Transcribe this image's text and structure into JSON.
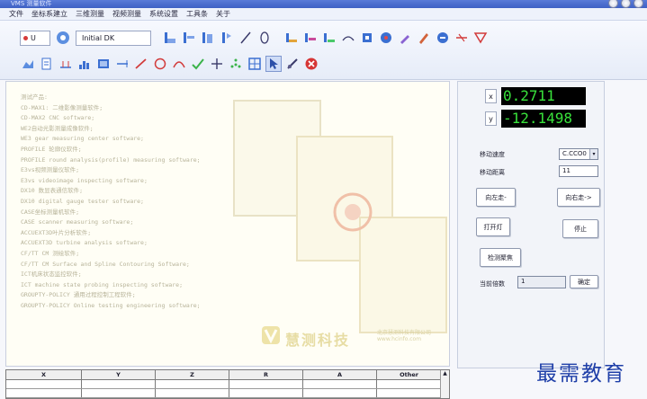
{
  "window": {
    "title": "VMS 测量软件"
  },
  "menu": [
    "文件",
    "坐标系建立",
    "三维测量",
    "视频测量",
    "系统设置",
    "工具条",
    "关于"
  ],
  "toolbar": {
    "unit_value": "U",
    "combo_value": "Initial DK",
    "row1_tools": [
      "point-tool-icon",
      "line-tool-icon",
      "circle-tool-icon",
      "arc-tool-icon",
      "line-draw-icon",
      "ellipse-tool-icon",
      "distance-tool-icon",
      "angle-tool-icon",
      "width-tool-icon",
      "arc-measure-icon",
      "rect-tool-icon",
      "probe-tool-icon",
      "pen-tool-icon",
      "edit-tool-icon",
      "erase-tool-icon",
      "cross-tool-icon",
      "filter-tool-icon"
    ],
    "row2_tools": [
      "area-tool-icon",
      "profile-tool-icon",
      "grid-tool-icon",
      "chart-tool-icon",
      "picture-tool-icon",
      "dimension-tool-icon",
      "red-line-icon",
      "circle-red-icon",
      "arc-red-icon",
      "check-tool-icon",
      "cross-hair-icon",
      "multi-point-icon",
      "frame-tool-icon",
      "select-tool-icon",
      "measure-tool-icon",
      "stop-red-icon"
    ],
    "active_tool": "select-tool-icon"
  },
  "canvas": {
    "lines": [
      "测试产品:",
      "CD-MAX1: 二维影像测量软件;",
      "CD-MAX2 CNC software;",
      "WE2自动光影测量成像软件;",
      "WE3 gear measuring center software;",
      "PROFILE 轮廓仪软件;",
      "PROFILE round analysis(profile) measuring software;",
      "E3vs视频测量仪软件;",
      "E3vs videoimage inspecting software;",
      "DX10 数显表通信软件;",
      "DX10 digital gauge tester software;",
      "CASE坐标测量机软件;",
      "CASE scanner measuring software;",
      "ACCUEXT3D叶片分析软件;",
      "ACCUEXT3D turbine analysis software;",
      "CF/TT CM 测绘软件;",
      "CF/TT CM Surface and Spline Contouring Software;",
      "ICT机床状态监控软件;",
      "ICT machine state probing inspecting software;",
      "GROUPTY-POLICY 通用过程控制工程软件;",
      "GROUPTY-POLICY Online testing engineering software;"
    ],
    "brand": "慧测科技",
    "brand_sub": "北京慧测科技有限公司 www.hcinfo.com"
  },
  "table": {
    "columns": [
      "X",
      "Y",
      "Z",
      "R",
      "A",
      "Other"
    ],
    "rows": [
      [
        "",
        "",
        "",
        "",
        "",
        ""
      ],
      [
        "",
        "",
        "",
        "",
        "",
        ""
      ]
    ]
  },
  "panel": {
    "x_readout": "0.2711",
    "y_readout": "-12.1498",
    "readout_btn_x": "x",
    "readout_btn_y": "y",
    "speed_label": "移动速度",
    "speed_value": "C.CCO0",
    "step_label": "移动距离",
    "step_value": "11",
    "btn_forward": "向左走-",
    "btn_backward": "向右走->",
    "btn_light": "打开灯",
    "btn_stop": "停止",
    "btn_focus": "检测聚焦",
    "zoom_label": "当前倍数",
    "zoom_value": "1",
    "btn_confirm": "确定"
  },
  "corner_logo": "最需教育",
  "colors": {
    "readout_bg": "#000000",
    "readout_fg": "#39e23b",
    "titlebar": "#4a6dcf"
  }
}
